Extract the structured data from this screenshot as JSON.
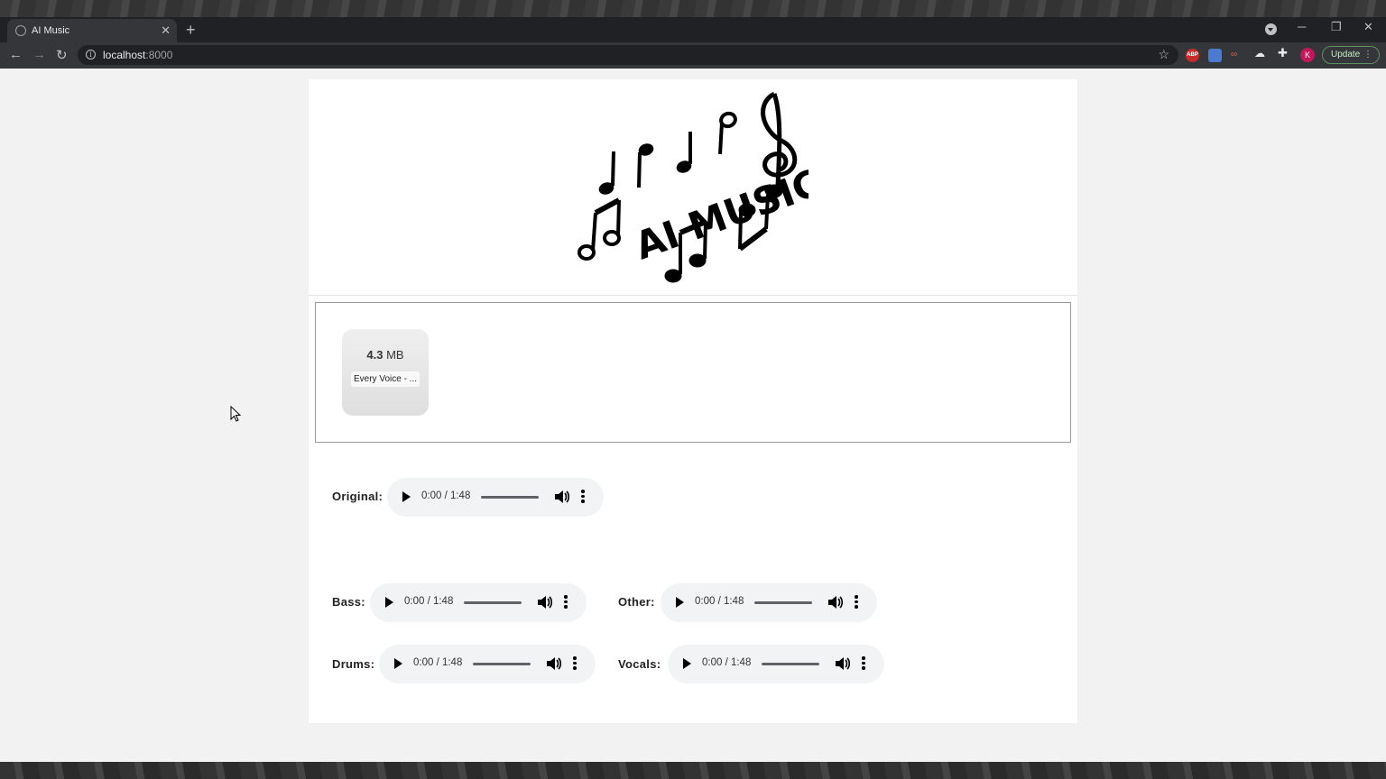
{
  "browser": {
    "tab_title": "AI Music",
    "url_host": "localhost",
    "url_port": ":8000",
    "avatar_initial": "K",
    "update_label": "Update"
  },
  "logo": {
    "text": "AI MUSIC"
  },
  "upload": {
    "file_size_value": "4.3",
    "file_size_unit": "MB",
    "file_name": "Every Voice - ..."
  },
  "players": {
    "original": {
      "label": "Original:",
      "time": "0:00 / 1:48"
    },
    "bass": {
      "label": "Bass:",
      "time": "0:00 / 1:48"
    },
    "other": {
      "label": "Other:",
      "time": "0:00 / 1:48"
    },
    "drums": {
      "label": "Drums:",
      "time": "0:00 / 1:48"
    },
    "vocals": {
      "label": "Vocals:",
      "time": "0:00 / 1:48"
    }
  },
  "colors": {
    "chrome_dark": "#202124",
    "chrome_toolbar": "#35363a",
    "page_bg": "#f2f2f2",
    "player_bg": "#f1f3f4"
  }
}
